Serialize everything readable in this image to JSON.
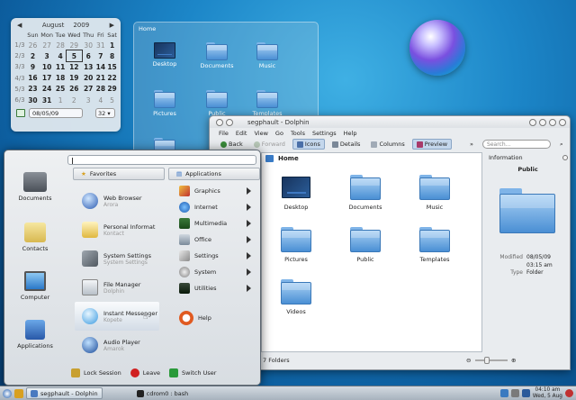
{
  "calendar": {
    "month": "August",
    "year": "2009",
    "weekdays": [
      "Sun",
      "Mon",
      "Tue",
      "Wed",
      "Thu",
      "Fri",
      "Sat"
    ],
    "weeks": [
      {
        "wk": "1/3",
        "days": [
          "26",
          "27",
          "28",
          "29",
          "30",
          "31",
          "1"
        ]
      },
      {
        "wk": "2/3",
        "days": [
          "2",
          "3",
          "4",
          "5",
          "6",
          "7",
          "8"
        ]
      },
      {
        "wk": "3/3",
        "days": [
          "9",
          "10",
          "11",
          "12",
          "13",
          "14",
          "15"
        ]
      },
      {
        "wk": "4/3",
        "days": [
          "16",
          "17",
          "18",
          "19",
          "20",
          "21",
          "22"
        ]
      },
      {
        "wk": "5/3",
        "days": [
          "23",
          "24",
          "25",
          "26",
          "27",
          "28",
          "29"
        ]
      },
      {
        "wk": "6/3",
        "days": [
          "30",
          "31",
          "1",
          "2",
          "3",
          "4",
          "5"
        ]
      }
    ],
    "date_value": "08/05/09",
    "week_value": "32"
  },
  "folderview": {
    "title": "Home",
    "items": [
      "Desktop",
      "Documents",
      "Music",
      "Pictures",
      "Public",
      "Templates"
    ]
  },
  "dolphin": {
    "title": "segphault - Dolphin",
    "menu": [
      "File",
      "Edit",
      "View",
      "Go",
      "Tools",
      "Settings",
      "Help"
    ],
    "toolbar": {
      "back": "Back",
      "forward": "Forward",
      "icons": "Icons",
      "details": "Details",
      "columns": "Columns",
      "preview": "Preview",
      "search_placeholder": "Search..."
    },
    "breadcrumb": "Home",
    "files": [
      "Desktop",
      "Documents",
      "Music",
      "Pictures",
      "Public",
      "Templates",
      "Videos"
    ],
    "status": "7 Folders",
    "info": {
      "heading": "Information",
      "name": "Public",
      "modified_label": "Modified",
      "modified_date": "08/05/09",
      "modified_time": "03:15 am",
      "type_label": "Type",
      "type_value": "Folder"
    }
  },
  "kickoff": {
    "sidebar": [
      "Documents",
      "Contacts",
      "Computer",
      "Applications"
    ],
    "favorites_header": "Favorites",
    "applications_header": "Applications",
    "favorites": [
      {
        "name": "Web Browser",
        "sub": "Arora"
      },
      {
        "name": "Personal Informat",
        "sub": "Kontact"
      },
      {
        "name": "System Settings",
        "sub": "System Settings"
      },
      {
        "name": "File Manager",
        "sub": "Dolphin"
      },
      {
        "name": "Instant Messenger",
        "sub": "Kopete"
      },
      {
        "name": "Audio Player",
        "sub": "Amarok"
      }
    ],
    "categories": [
      "Graphics",
      "Internet",
      "Multimedia",
      "Office",
      "Settings",
      "System",
      "Utilities",
      "Help"
    ],
    "footer": {
      "lock": "Lock Session",
      "leave": "Leave",
      "switch": "Switch User"
    }
  },
  "taskbar": {
    "tasks": [
      "segphault - Dolphin",
      "cdrom0 : bash"
    ],
    "time": "04:10 am",
    "date": "Wed, 5 Aug"
  }
}
